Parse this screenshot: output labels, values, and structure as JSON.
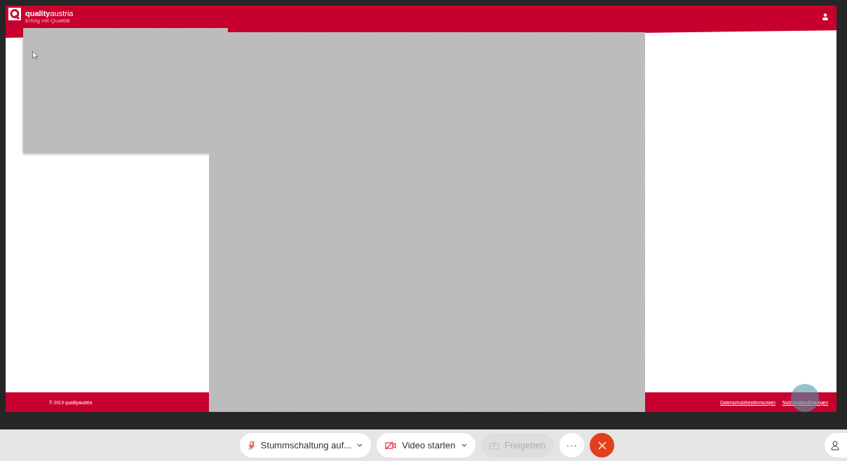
{
  "header": {
    "brand": "**quality**austria",
    "tagline": "Erfolg mit Qualität"
  },
  "footer": {
    "copyright": "© 2019 qualityaustria",
    "links": [
      "Datenschutzbestimmungen",
      "Nutzungsbedingungen"
    ]
  },
  "toolbar": {
    "buttons": [
      {
        "kind": "mute",
        "label": "Stummschaltung auf...",
        "disabled": false
      },
      {
        "kind": "video",
        "label": "Video starten",
        "disabled": false
      },
      {
        "kind": "share",
        "label": "Freigeben",
        "disabled": true
      },
      {
        "kind": "more",
        "label": "···",
        "disabled": false
      },
      {
        "kind": "end",
        "disabled": false
      }
    ]
  }
}
